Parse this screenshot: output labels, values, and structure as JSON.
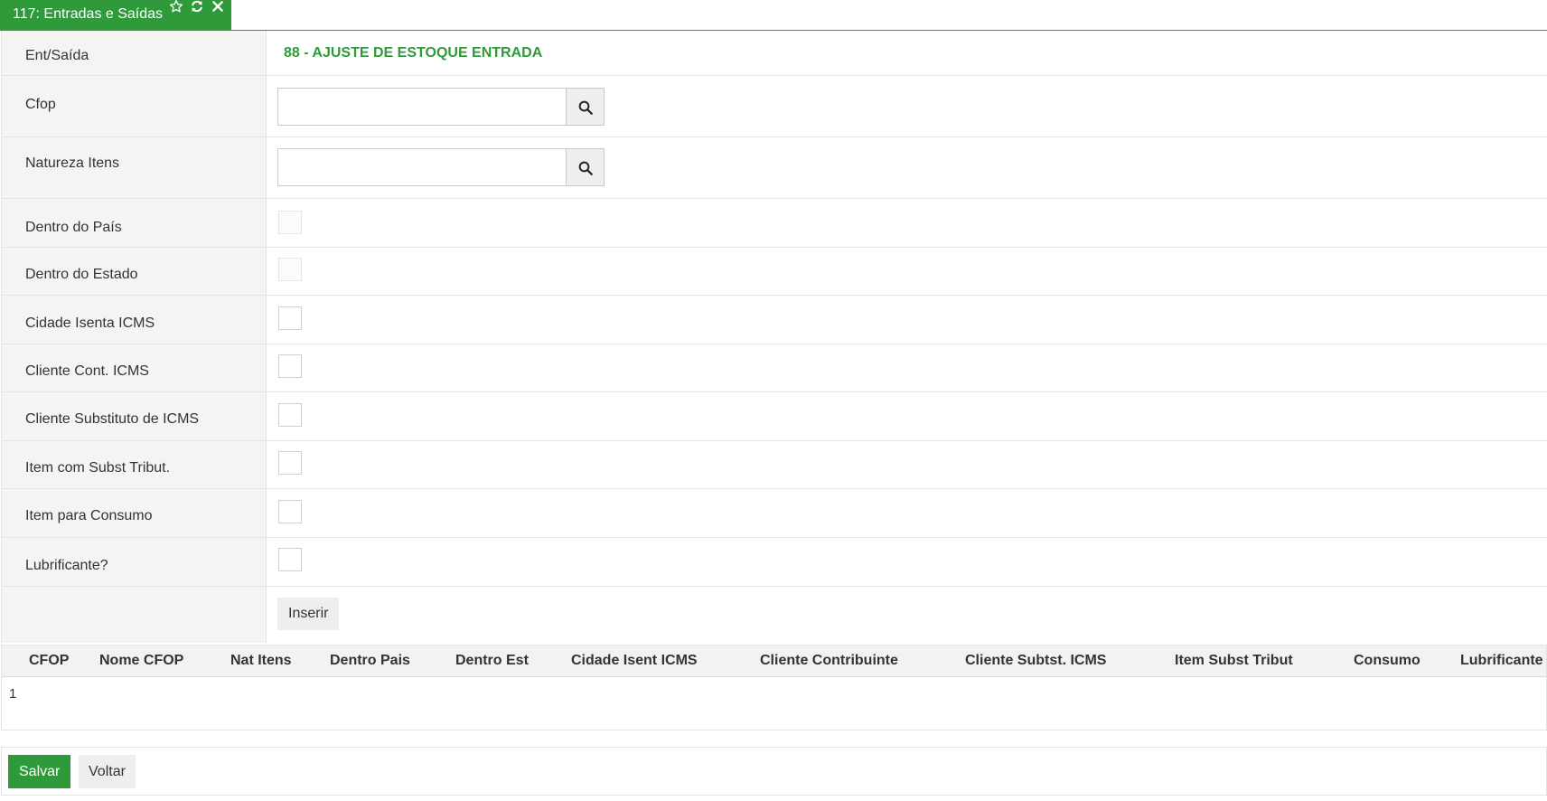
{
  "tab": {
    "title": "117: Entradas e Saídas",
    "icons": [
      "star-icon",
      "refresh-icon",
      "close-icon"
    ]
  },
  "form": {
    "ent_saida": {
      "label": "Ent/Saída",
      "value": "88 - AJUSTE DE ESTOQUE ENTRADA"
    },
    "cfop": {
      "label": "Cfop",
      "value": "",
      "placeholder": ""
    },
    "natureza_itens": {
      "label": "Natureza Itens",
      "value": "",
      "placeholder": ""
    },
    "checkboxes": [
      {
        "label": "Dentro do País",
        "checked": false,
        "disabled": true
      },
      {
        "label": "Dentro do Estado",
        "checked": false,
        "disabled": true
      },
      {
        "label": "Cidade Isenta ICMS",
        "checked": false,
        "disabled": false
      },
      {
        "label": "Cliente Cont. ICMS",
        "checked": false,
        "disabled": false
      },
      {
        "label": "Cliente Substituto de ICMS",
        "checked": false,
        "disabled": false
      },
      {
        "label": "Item com Subst Tribut.",
        "checked": false,
        "disabled": false
      },
      {
        "label": "Item para Consumo",
        "checked": false,
        "disabled": false
      },
      {
        "label": "Lubrificante?",
        "checked": false,
        "disabled": false
      }
    ],
    "insert_label": "Inserir"
  },
  "grid": {
    "columns": [
      "CFOP",
      "Nome CFOP",
      "Nat Itens",
      "Dentro Pais",
      "Dentro Est",
      "Cidade Isent ICMS",
      "Cliente Contribuinte",
      "Cliente Subtst. ICMS",
      "Item Subst Tribut",
      "Consumo",
      "Lubrificante"
    ],
    "page": "1"
  },
  "footer": {
    "save_label": "Salvar",
    "back_label": "Voltar"
  },
  "colors": {
    "accent": "#2e9a3a",
    "label_bg": "#f4f4f4",
    "button_bg": "#eeeeee"
  }
}
